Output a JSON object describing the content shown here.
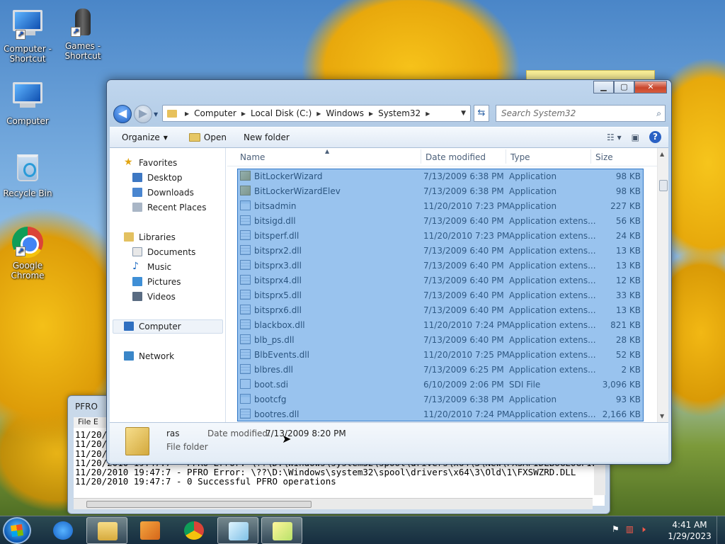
{
  "desktop": {
    "icons": [
      {
        "label": "Computer - Shortcut",
        "icon": "computer-icon"
      },
      {
        "label": "Games - Shortcut",
        "icon": "games-icon"
      },
      {
        "label": "Computer",
        "icon": "computer-icon"
      },
      {
        "label": "Recycle Bin",
        "icon": "recycle-bin-icon"
      },
      {
        "label": "Google Chrome",
        "icon": "chrome-icon"
      }
    ]
  },
  "console": {
    "title": "PFRO",
    "menu": "File   E",
    "lines": [
      "11/20/",
      "11/20/",
      "11/20/",
      "11/20/2010 19:47:7 - PFRO Error: \\??\\D:\\Windows\\system32\\spool\\drivers\\x64\\3\\New\\FXSAPIDEBUGLOGFILE.TXT",
      "11/20/2010 19:47:7 - PFRO Error: \\??\\D:\\Windows\\system32\\spool\\drivers\\x64\\3\\Old\\1\\FXSWZRD.DLL",
      "11/20/2010 19:47:7 - 0 Successful PFRO operations"
    ]
  },
  "explorer": {
    "address": {
      "crumbs": [
        "Computer",
        "Local Disk (C:)",
        "Windows",
        "System32"
      ]
    },
    "search": {
      "placeholder": "Search System32"
    },
    "toolbar": {
      "organize": "Organize",
      "open": "Open",
      "new_folder": "New folder"
    },
    "nav": {
      "favorites": "Favorites",
      "desktop": "Desktop",
      "downloads": "Downloads",
      "recent_places": "Recent Places",
      "libraries": "Libraries",
      "documents": "Documents",
      "music": "Music",
      "pictures": "Pictures",
      "videos": "Videos",
      "computer": "Computer",
      "network": "Network"
    },
    "columns": {
      "name": "Name",
      "date": "Date modified",
      "type": "Type",
      "size": "Size"
    },
    "files": [
      {
        "name": "BitLockerWizard",
        "date": "7/13/2009 6:38 PM",
        "type": "Application",
        "size": "98 KB",
        "icon": "app"
      },
      {
        "name": "BitLockerWizardElev",
        "date": "7/13/2009 6:38 PM",
        "type": "Application",
        "size": "98 KB",
        "icon": "app"
      },
      {
        "name": "bitsadmin",
        "date": "11/20/2010 7:23 PM",
        "type": "Application",
        "size": "227 KB",
        "icon": "exe"
      },
      {
        "name": "bitsigd.dll",
        "date": "7/13/2009 6:40 PM",
        "type": "Application extens...",
        "size": "56 KB",
        "icon": "dll"
      },
      {
        "name": "bitsperf.dll",
        "date": "11/20/2010 7:23 PM",
        "type": "Application extens...",
        "size": "24 KB",
        "icon": "dll"
      },
      {
        "name": "bitsprx2.dll",
        "date": "7/13/2009 6:40 PM",
        "type": "Application extens...",
        "size": "13 KB",
        "icon": "dll"
      },
      {
        "name": "bitsprx3.dll",
        "date": "7/13/2009 6:40 PM",
        "type": "Application extens...",
        "size": "13 KB",
        "icon": "dll"
      },
      {
        "name": "bitsprx4.dll",
        "date": "7/13/2009 6:40 PM",
        "type": "Application extens...",
        "size": "12 KB",
        "icon": "dll"
      },
      {
        "name": "bitsprx5.dll",
        "date": "7/13/2009 6:40 PM",
        "type": "Application extens...",
        "size": "33 KB",
        "icon": "dll"
      },
      {
        "name": "bitsprx6.dll",
        "date": "7/13/2009 6:40 PM",
        "type": "Application extens...",
        "size": "13 KB",
        "icon": "dll"
      },
      {
        "name": "blackbox.dll",
        "date": "11/20/2010 7:24 PM",
        "type": "Application extens...",
        "size": "821 KB",
        "icon": "dll"
      },
      {
        "name": "blb_ps.dll",
        "date": "7/13/2009 6:40 PM",
        "type": "Application extens...",
        "size": "28 KB",
        "icon": "dll"
      },
      {
        "name": "BlbEvents.dll",
        "date": "11/20/2010 7:25 PM",
        "type": "Application extens...",
        "size": "52 KB",
        "icon": "dll"
      },
      {
        "name": "blbres.dll",
        "date": "7/13/2009 6:25 PM",
        "type": "Application extens...",
        "size": "2 KB",
        "icon": "dll"
      },
      {
        "name": "boot.sdi",
        "date": "6/10/2009 2:06 PM",
        "type": "SDI File",
        "size": "3,096 KB",
        "icon": "file"
      },
      {
        "name": "bootcfg",
        "date": "7/13/2009 6:38 PM",
        "type": "Application",
        "size": "93 KB",
        "icon": "exe"
      },
      {
        "name": "bootres.dll",
        "date": "11/20/2010 7:24 PM",
        "type": "Application extens...",
        "size": "2,166 KB",
        "icon": "dll"
      }
    ],
    "details": {
      "name": "ras",
      "type": "File folder",
      "date_label": "Date modified:",
      "date_value": "7/13/2009 8:20 PM"
    }
  },
  "taskbar": {
    "apps": [
      "explorer-icon",
      "internet-explorer-icon",
      "media-player-icon",
      "chrome-icon",
      "notepad-icon",
      "sticky-notes-icon"
    ],
    "clock": {
      "time": "4:41 AM",
      "date": "1/29/2023"
    }
  }
}
